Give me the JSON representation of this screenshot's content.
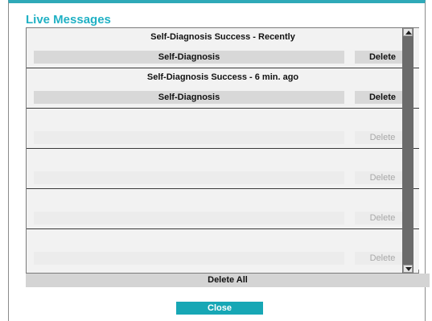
{
  "dialog": {
    "title": "Live Messages",
    "accent_color": "#20b1c4"
  },
  "messages": [
    {
      "text": "Self-Diagnosis Success - Recently",
      "type": "Self-Diagnosis",
      "delete_label": "Delete"
    },
    {
      "text": "Self-Diagnosis Success - 6 min. ago",
      "type": "Self-Diagnosis",
      "delete_label": "Delete"
    },
    {
      "text": "",
      "type": "",
      "delete_label": "Delete"
    },
    {
      "text": "",
      "type": "",
      "delete_label": "Delete"
    },
    {
      "text": "",
      "type": "",
      "delete_label": "Delete"
    },
    {
      "text": "",
      "type": "",
      "delete_label": "Delete"
    }
  ],
  "scrollbar": {
    "up_icon": "triangle-up-icon",
    "down_icon": "triangle-down-icon"
  },
  "actions": {
    "delete_all_label": "Delete All",
    "close_label": "Close",
    "close_color": "#17a7b5"
  }
}
